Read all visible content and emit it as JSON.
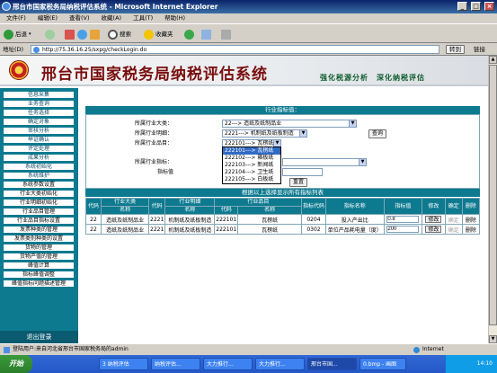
{
  "window": {
    "title": "邢台市国家税务局纳税评估系统 - Microsoft Internet Explorer",
    "min": "_",
    "max": "□",
    "close": "×"
  },
  "menu": [
    "文件(F)",
    "编辑(E)",
    "查看(V)",
    "收藏(A)",
    "工具(T)",
    "帮助(H)"
  ],
  "toolbar": {
    "back": "后退",
    "search": "搜索",
    "favorites": "收藏夹"
  },
  "address": {
    "label": "地址(D)",
    "url": "http://75.36.16.25/sxpg/checkLogin.do",
    "go": "转到",
    "links": "链接"
  },
  "banner": {
    "title": "邢台市国家税务局纳税评估系统",
    "slogan": "强化税源分析　深化纳税评估"
  },
  "sidebar": {
    "items": [
      "信息采集",
      "业务查询",
      "任务选择",
      "确定对象",
      "审核分析",
      "举证确认",
      "评定处理",
      "成果分析",
      "系统初始化",
      "系统维护"
    ],
    "subitems": [
      "系统参数设置",
      "行业大类初始化",
      "行业明细初始化",
      "行业品目管理",
      "行业品目指标设置",
      "发票种类的管理",
      "发票类别种类的设置",
      "货物的管理",
      "货物产值的管理",
      "峰值计算",
      "指标峰值调整",
      "峰值指标问题描述管理"
    ],
    "logout": "退出登录"
  },
  "form": {
    "heading": "行业指标值：",
    "label_category": "所属行业大类：",
    "value_category": "22---> 造纸及纸制品业",
    "label_detail": "所属行业明细：",
    "value_detail": "2221---> 机制纸及纸板制造",
    "label_item": "所属行业品目：",
    "value_item": "222101---> 瓦楞纸",
    "query": "查询",
    "label_indicator": "所属行业指标：",
    "label_value": "指标值",
    "reset": "重置",
    "dropdown_options": [
      "222101---> 瓦楞纸",
      "222102---> 箱板纸",
      "222103---> 新闻纸",
      "222104---> 卫生纸",
      "222105---> 白板纸"
    ]
  },
  "grid": {
    "caption": "根据以上选择显示所有指标列表",
    "group_headers": [
      "行业大类",
      "行业明细",
      "行业品目"
    ],
    "sub_headers": [
      "代码",
      "名称",
      "代码",
      "名称",
      "代码",
      "名称"
    ],
    "col_headers": [
      "指标代码",
      "指标名称",
      "指标值",
      "修改",
      "确定",
      "删除"
    ],
    "rows": [
      {
        "c1": "22",
        "n1": "造纸及纸制品业",
        "c2": "2221",
        "n2": "机制纸及纸板制造",
        "c3": "222101",
        "n3": "瓦楞纸",
        "code": "0204",
        "name": "投入产出比",
        "value": "0.8",
        "edit": "修改",
        "ok": "确定",
        "del": "删除"
      },
      {
        "c1": "22",
        "n1": "造纸及纸制品业",
        "c2": "2221",
        "n2": "机制纸及纸板制造",
        "c3": "222101",
        "n3": "瓦楞纸",
        "code": "0302",
        "name": "单位产品耗电量（度）",
        "value": "200",
        "edit": "修改",
        "ok": "确定",
        "del": "删除"
      }
    ]
  },
  "status": {
    "text": "登陆用户:来自河北省邢台市国家税务局的admin",
    "zone": "Internet"
  },
  "taskbar": {
    "start": "开始",
    "tasks": [
      "3 纳税评估",
      "纳税评估...",
      "大力推行...",
      "大力推行...",
      "邢台市国...",
      "0.bmp - 画图"
    ],
    "clock": "14:10"
  }
}
